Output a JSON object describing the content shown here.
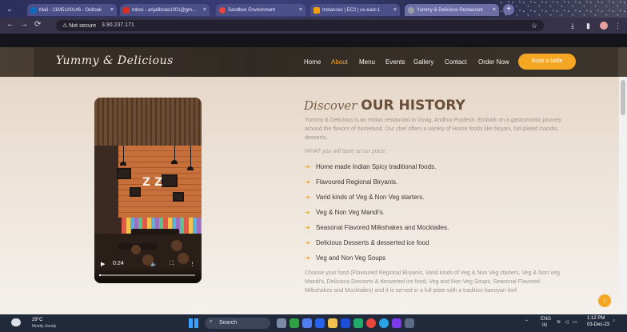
{
  "browser": {
    "tabs": [
      {
        "title": "Mail - 21M51A0146 - Outlook",
        "favicon_color": "#0f6cbd"
      },
      {
        "title": "Inbox - anjaliboda1001@gm...",
        "favicon_color": "#d93025"
      },
      {
        "title": "Sandbox Environment",
        "favicon_color": "#e8453c"
      },
      {
        "title": "Instances | EC2 | us-east-1",
        "favicon_color": "#f59e0b"
      },
      {
        "title": "Yummy & Delicious Restaurant",
        "favicon_color": "#9aa0a6"
      }
    ],
    "active_tab_index": 4,
    "new_tab_glyph": "+",
    "security_label": "Not secure",
    "url": "3.90.237.171"
  },
  "site": {
    "logo": "Yummy & Delicious",
    "nav": [
      "Home",
      "About",
      "Menu",
      "Events",
      "Gallery",
      "Contact",
      "Order Now"
    ],
    "active_nav": "About",
    "book_button": "Book a table",
    "accent_color": "#f5a623"
  },
  "about": {
    "heading_prefix": "Discover",
    "heading_main": "OUR HISTORY",
    "intro": "Yummy & Delicious is an Indian restaurant in Vizag, Andhra Pradesh. Embark on a gastronomic journey around the flavors of homeland. Our chef offers a variety of Home foods like biryani, full plated mandis, desserts.",
    "taste_label": "WHAT you will taste at our place :",
    "features": [
      "Home made Indian Spicy traditional foods.",
      "Flavoured Regional Biryanis.",
      "Varid kinds of Veg & Non Veg starters.",
      "Veg & Non Veg Mandi's.",
      "Seasonal Flavored Milkshakes and Mocktailes.",
      "Delicious Desserts & desserted ice food",
      "Veg and Non Veg Soups"
    ],
    "outro": "Choose your food (Flavoured Regional Biryanis, Varid kinds of Veg & Non Veg starters, Veg & Non Veg Mandi's, Delicious Desserts & desserted ice food, Veg and Non Veg Soups, Seasonal Flavored Milkshakes and Mocktailes) and it is served in a full plate with a tradition banoyan leef."
  },
  "video": {
    "time": "0:24",
    "progress": 0.02
  },
  "taskbar": {
    "temperature": "29°C",
    "weather": "Mostly cloudy",
    "search_label": "Search",
    "language": "ENG",
    "region": "IN",
    "time": "1:12 PM",
    "date": "03-Dec-23"
  }
}
